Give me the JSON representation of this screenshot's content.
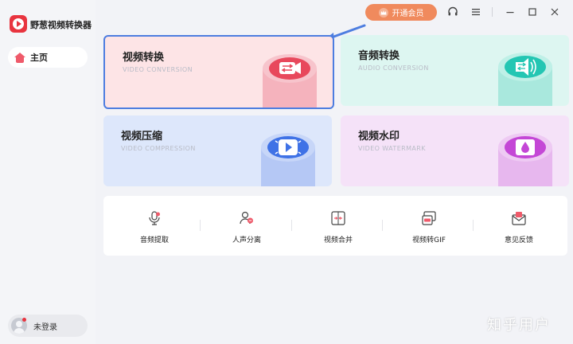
{
  "app": {
    "name": "野葱视频转换器"
  },
  "sidebar": {
    "home_label": "主页",
    "login_label": "未登录"
  },
  "titlebar": {
    "vip_label": "开通会员"
  },
  "cards": [
    {
      "title": "视频转换",
      "subtitle": "VIDEO CONVERSION",
      "icon": "video-convert-icon",
      "color": "#e8485c"
    },
    {
      "title": "音频转换",
      "subtitle": "AUDIO CONVERSION",
      "icon": "audio-convert-icon",
      "color": "#23c6b3"
    },
    {
      "title": "视频压缩",
      "subtitle": "VIDEO COMPRESSION",
      "icon": "video-compress-icon",
      "color": "#3f72e6"
    },
    {
      "title": "视频水印",
      "subtitle": "VIDEO WATERMARK",
      "icon": "video-watermark-icon",
      "color": "#c447d6"
    }
  ],
  "tools": [
    {
      "label": "音频提取",
      "icon": "microphone-icon"
    },
    {
      "label": "人声分离",
      "icon": "voice-separate-icon"
    },
    {
      "label": "视频合并",
      "icon": "video-merge-icon"
    },
    {
      "label": "视频转GIF",
      "icon": "gif-icon"
    },
    {
      "label": "意见反馈",
      "icon": "feedback-mail-icon"
    }
  ],
  "watermark": "知乎用户",
  "colors": {
    "accent": "#e8343f",
    "vip": "#f08a5d",
    "highlight_border": "#4d7de0"
  }
}
